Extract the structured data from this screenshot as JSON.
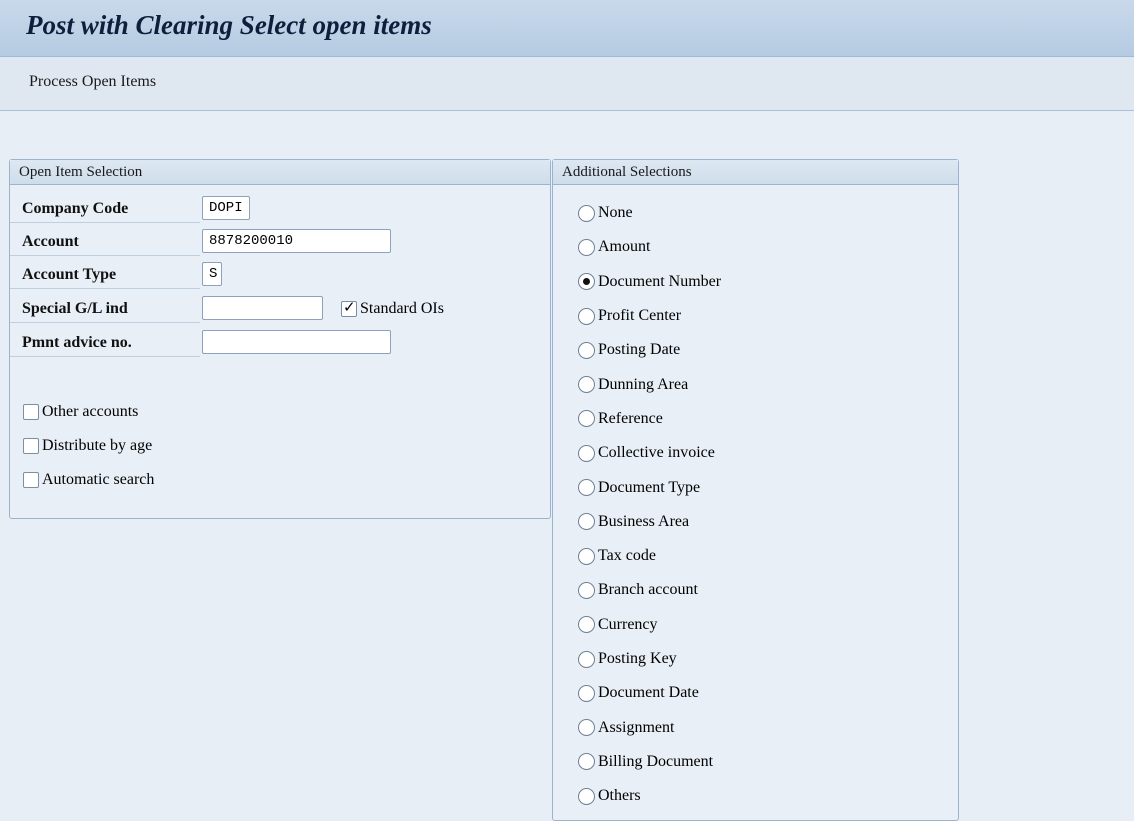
{
  "window": {
    "title": "Post with Clearing Select open items"
  },
  "toolbar": {
    "process_open_items": "Process Open Items"
  },
  "open_item_selection": {
    "header": "Open Item Selection",
    "company_code": {
      "label": "Company Code",
      "value": "DOPI"
    },
    "account": {
      "label": "Account",
      "value": "8878200010"
    },
    "account_type": {
      "label": "Account Type",
      "value": "S"
    },
    "special_gl_ind": {
      "label": "Special G/L ind",
      "value": ""
    },
    "standard_ois": {
      "label": "Standard OIs",
      "checked": true
    },
    "pmnt_advice_no": {
      "label": "Pmnt advice no.",
      "value": ""
    },
    "other_accounts": {
      "label": "Other accounts",
      "checked": false
    },
    "distribute_by_age": {
      "label": "Distribute by age",
      "checked": false
    },
    "automatic_search": {
      "label": "Automatic search",
      "checked": false
    }
  },
  "additional_selections": {
    "header": "Additional Selections",
    "selected": "Document Number",
    "options": [
      "None",
      "Amount",
      "Document Number",
      "Profit Center",
      "Posting Date",
      "Dunning Area",
      "Reference",
      "Collective invoice",
      "Document Type",
      "Business Area",
      "Tax code",
      "Branch account",
      "Currency",
      "Posting Key",
      "Document Date",
      "Assignment",
      "Billing Document",
      "Others"
    ]
  }
}
